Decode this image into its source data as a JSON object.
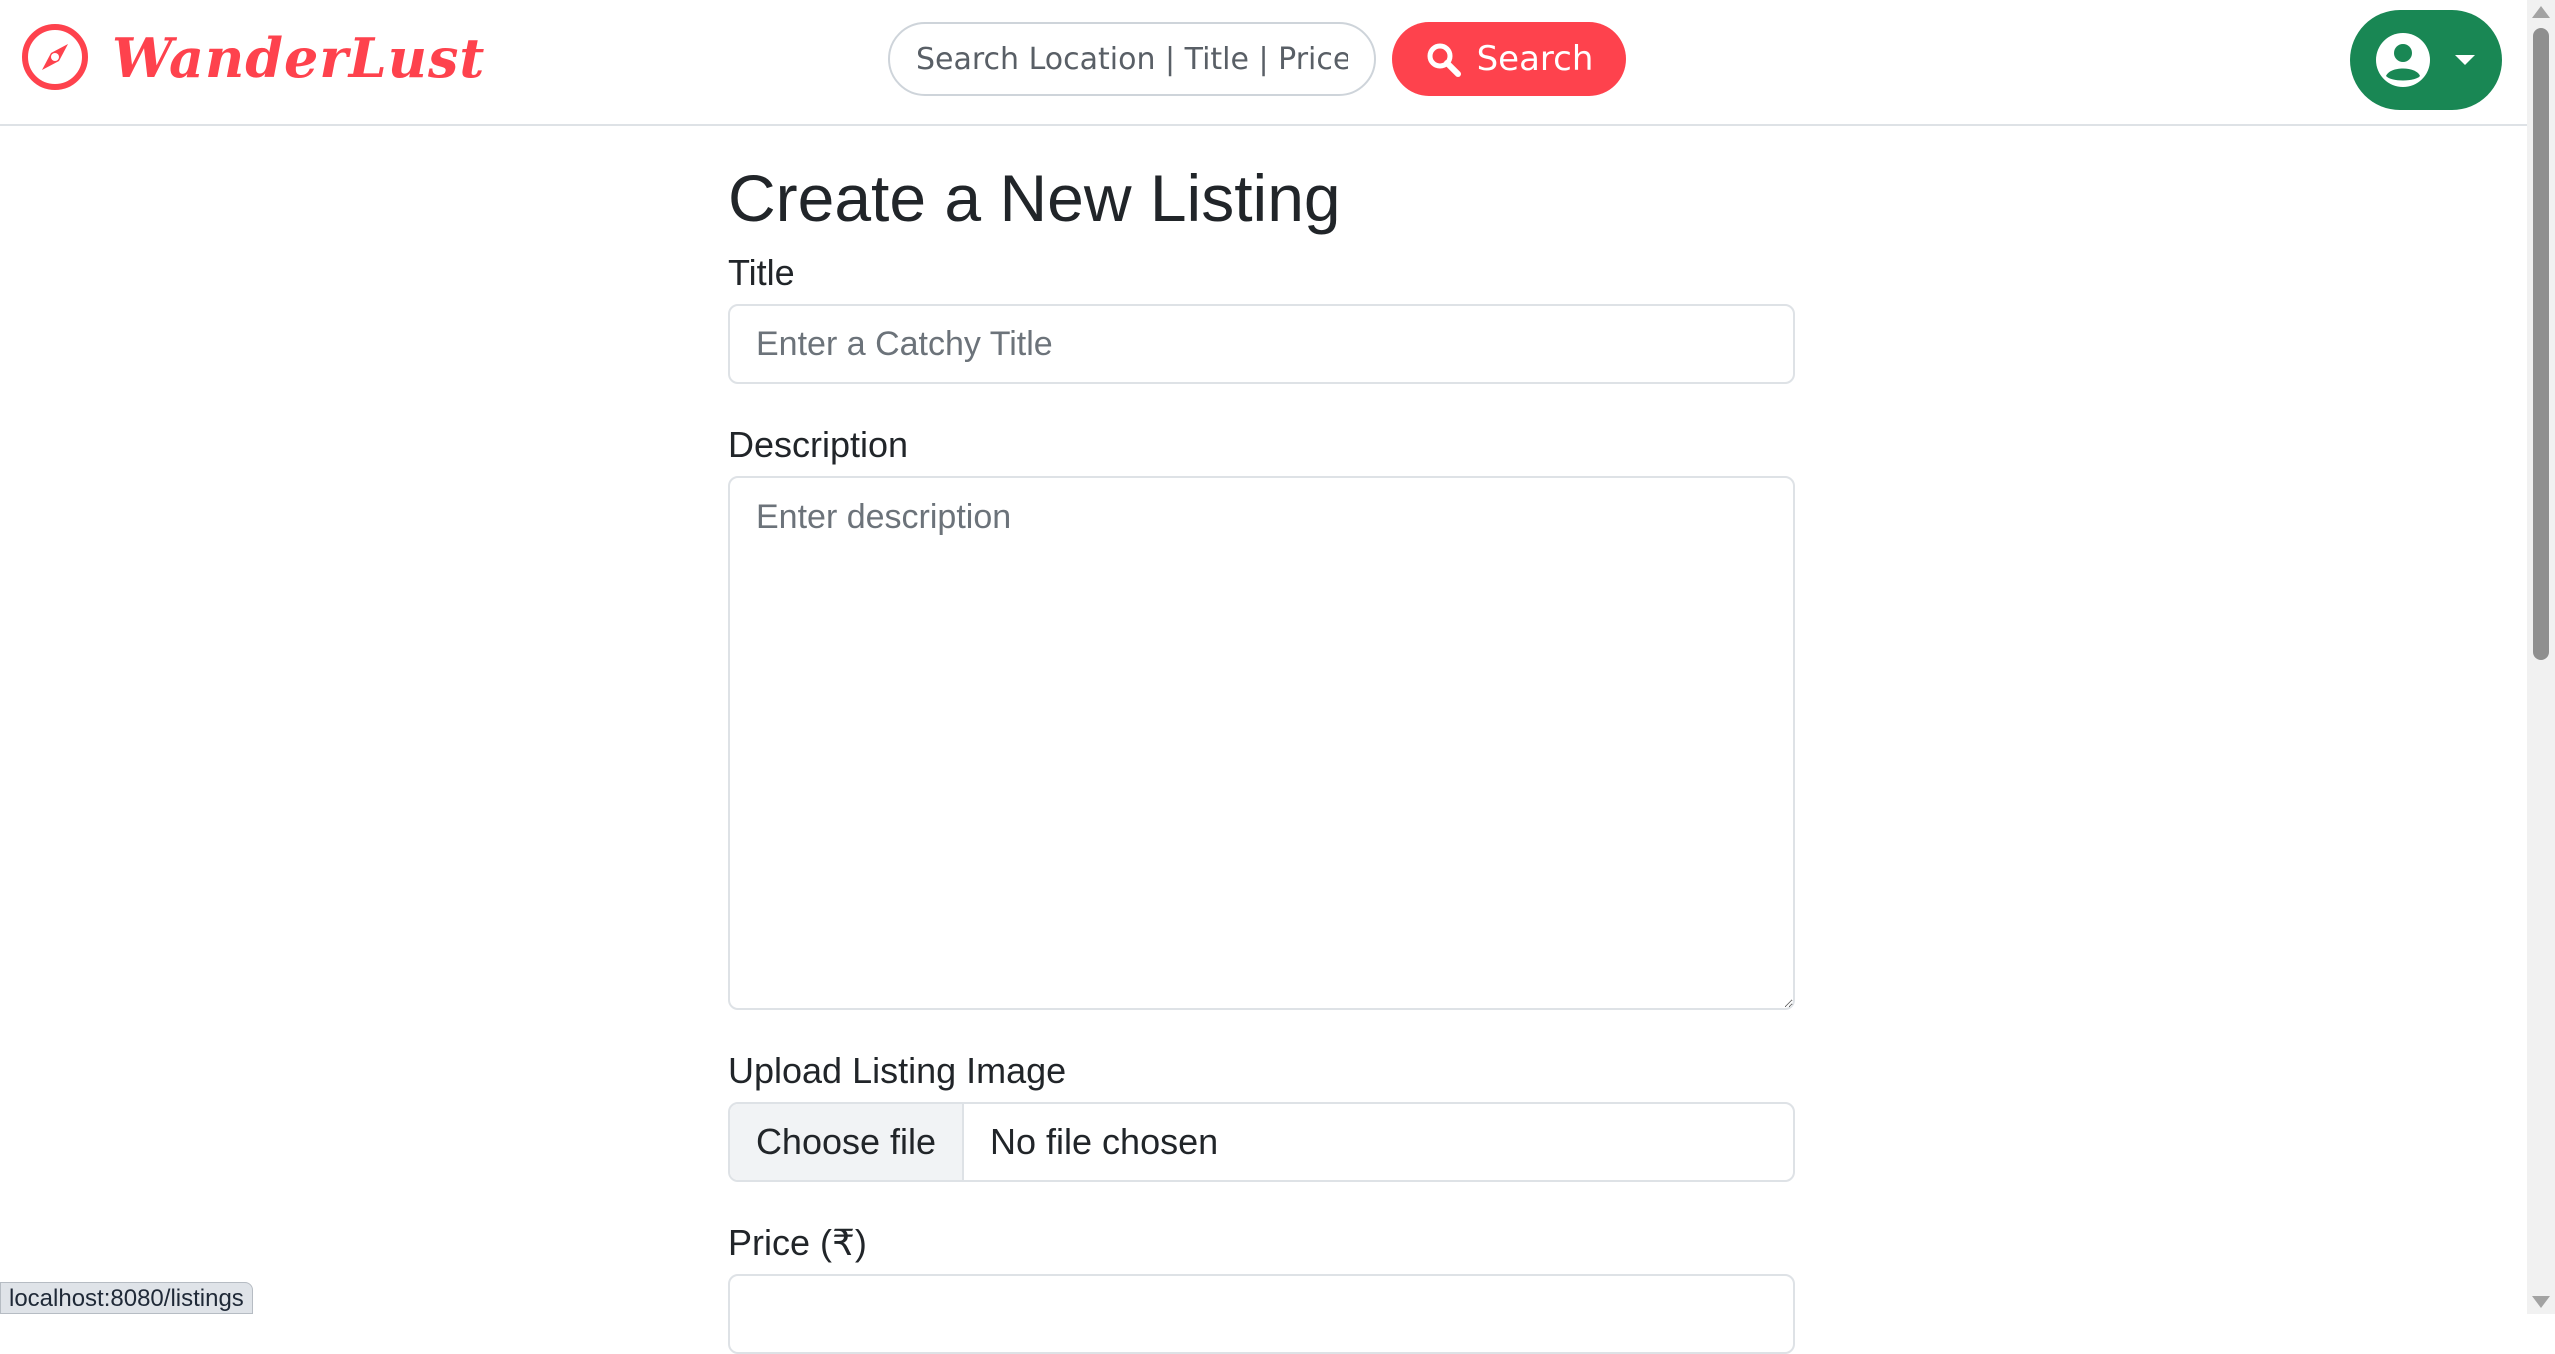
{
  "brand": {
    "name": "WanderLust",
    "icon": "compass-icon",
    "color": "#fe424d"
  },
  "search": {
    "placeholder": "Search Location | Title | Price",
    "button_label": "Search",
    "button_icon": "search-icon",
    "button_color": "#fe424d"
  },
  "user_menu": {
    "icon": "user-circle-icon",
    "caret": "caret-down-icon",
    "color": "#198754"
  },
  "form": {
    "title": "Create a New Listing",
    "title_field": {
      "label": "Title",
      "placeholder": "Enter a Catchy Title"
    },
    "description_field": {
      "label": "Description",
      "placeholder": "Enter description"
    },
    "image_field": {
      "label": "Upload Listing Image",
      "button_label": "Choose file",
      "status": "No file chosen"
    },
    "price_field": {
      "label": "Price (₹)"
    }
  },
  "status_bar": {
    "url": "localhost:8080/listings"
  }
}
